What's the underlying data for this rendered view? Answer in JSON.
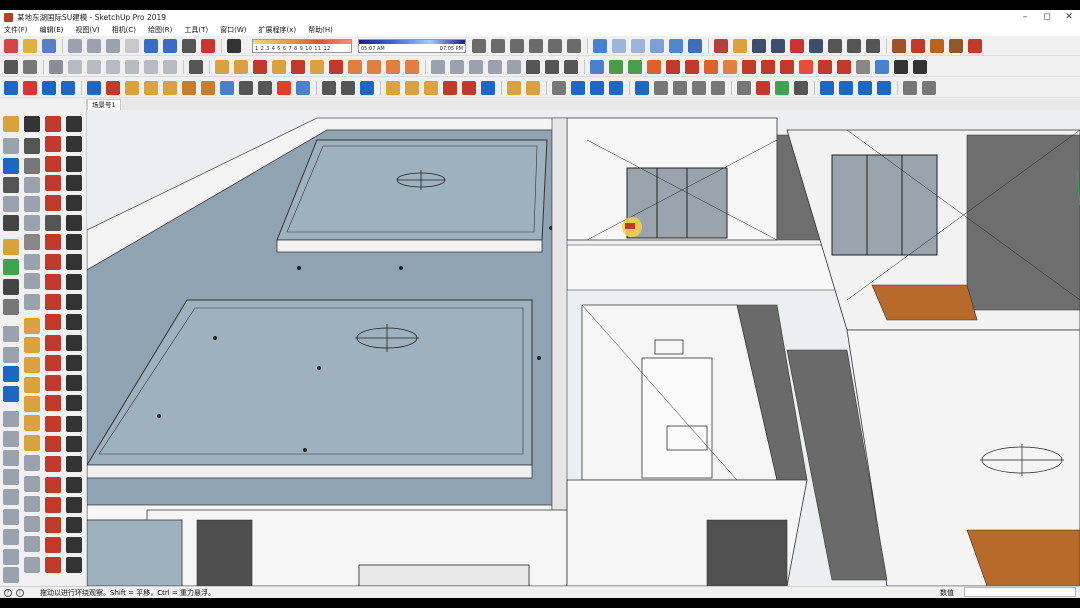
{
  "window": {
    "title": "某地东湖国际SU建模 - SketchUp Pro 2019",
    "controls": [
      "minimize-icon",
      "maximize-icon",
      "close-icon"
    ]
  },
  "menu": {
    "items": [
      "文件(F)",
      "编辑(E)",
      "视图(V)",
      "相机(C)",
      "绘图(R)",
      "工具(T)",
      "窗口(W)",
      "扩展程序(x)",
      "帮助(H)"
    ]
  },
  "shadow": {
    "months": "1 2 3 4 5 6 7 8 9 10 11 12",
    "time_start": "05:07 AM",
    "time_end": "07:05 PM"
  },
  "scene": {
    "tab_label": "场景号1"
  },
  "status": {
    "hint": "拖动以进行环绕观察。Shift = 平移，Ctrl = 重力悬浮。",
    "measurements_label": "数值",
    "measurements_value": ""
  },
  "colors": {
    "floor_slab": "#8fa3b3",
    "wall_white": "#f7f7f7",
    "wood_floor": "#b86a2a",
    "toolbar_bg": "#f0f0f0"
  },
  "toolbar_icons": {
    "row1": [
      "new-file-icon",
      "open-folder-icon",
      "save-icon",
      "cut-icon",
      "copy-icon",
      "paste-icon",
      "erase-icon",
      "undo-icon",
      "redo-icon",
      "print-icon",
      "model-info-icon",
      "shadow-toggle-icon",
      "iso-view-icon",
      "top-view-icon",
      "front-view-icon",
      "right-view-icon",
      "back-view-icon",
      "left-view-icon",
      "xray-icon",
      "wireframe-icon",
      "hidden-line-icon",
      "shaded-icon",
      "textured-icon",
      "monochrome-icon",
      "orbit-icon",
      "pan-icon",
      "zoom-icon",
      "zoom-window-icon",
      "zoom-extents-icon",
      "previous-view-icon",
      "position-camera-icon",
      "look-around-icon",
      "walk-icon",
      "section-plane-icon",
      "extension-warehouse-icon",
      "3d-warehouse-icon",
      "layout-icon",
      "style-builder-icon"
    ],
    "row2": [
      "select-icon",
      "make-component-icon",
      "paint-bucket-icon",
      "eraser-icon",
      "box-icon",
      "cylinder-icon",
      "sphere-icon",
      "cone-icon",
      "torus-icon",
      "tube-icon",
      "push-pull-icon",
      "follow-me-icon",
      "offset-icon",
      "move-icon",
      "rotate-icon",
      "scale-icon",
      "intersect-icon",
      "text-icon",
      "dimension-icon",
      "axes-icon",
      "grid-icon",
      "terrain-icon",
      "arrow-icon",
      "bevel-icon",
      "round-corner-icon",
      "curve-icon",
      "spline-icon",
      "lathe-icon",
      "extrude-icon",
      "loft-icon",
      "shell-icon",
      "chamfer-icon",
      "fillet-icon"
    ],
    "row3": [
      "component-browser-icon",
      "delete-icon",
      "trash-icon",
      "shopping-cart-icon",
      "roof-icon",
      "stair-icon",
      "window-icon",
      "door-icon",
      "wall-icon",
      "floor-icon",
      "tiles-icon",
      "fps-icon",
      "sketch-icon",
      "color-picker-icon",
      "grid-paint-icon",
      "material-icon",
      "lines-icon",
      "cleanup-icon",
      "export-icon",
      "import-icon",
      "tape-icon",
      "protractor-icon",
      "curve-line-icon",
      "arc-icon",
      "plugin-icon"
    ]
  }
}
